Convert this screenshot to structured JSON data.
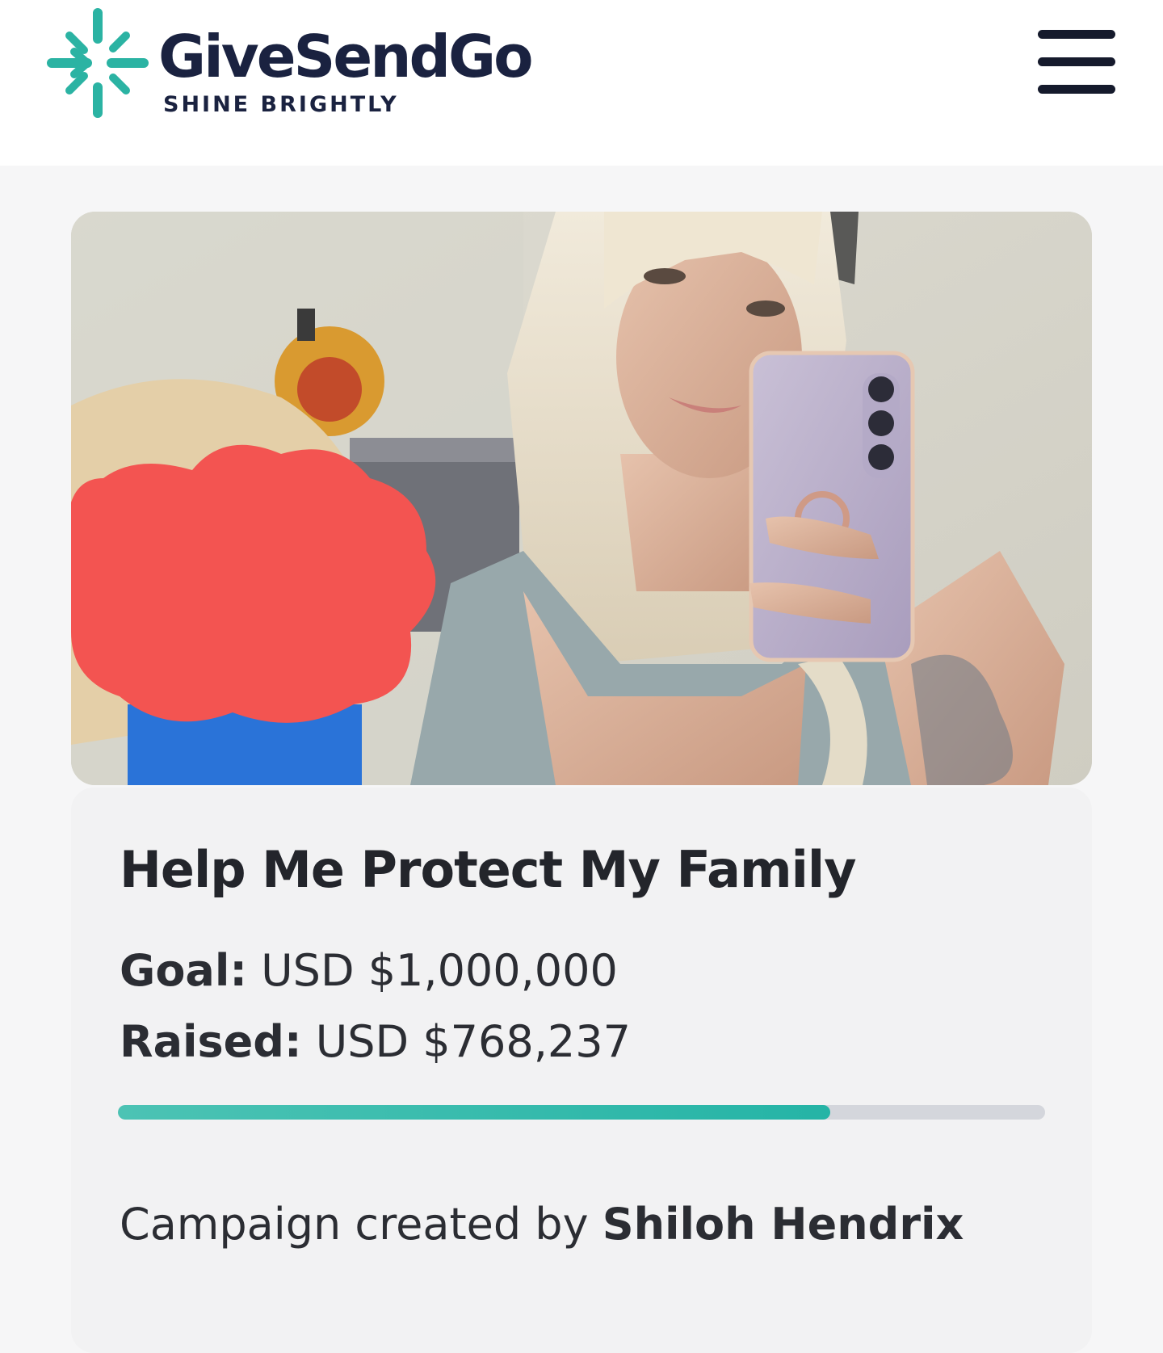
{
  "header": {
    "brand_name": "GiveSendGo",
    "tagline": "SHINE BRIGHTLY",
    "menu_icon": "hamburger-menu-icon",
    "brand_color": "#2bb3a3",
    "brand_text_color": "#1a2240"
  },
  "campaign": {
    "hero_image": "photo-selfie-woman-with-phone-and-redacted-child",
    "title": "Help Me Protect My Family",
    "goal_label": "Goal:",
    "goal_value": "USD $1,000,000",
    "raised_label": "Raised:",
    "raised_value": "USD $768,237",
    "progress_fraction": 0.768237,
    "progress_color": "#2bb3a3",
    "creator_prefix": "Campaign created by",
    "creator_name": "Shiloh Hendrix"
  }
}
